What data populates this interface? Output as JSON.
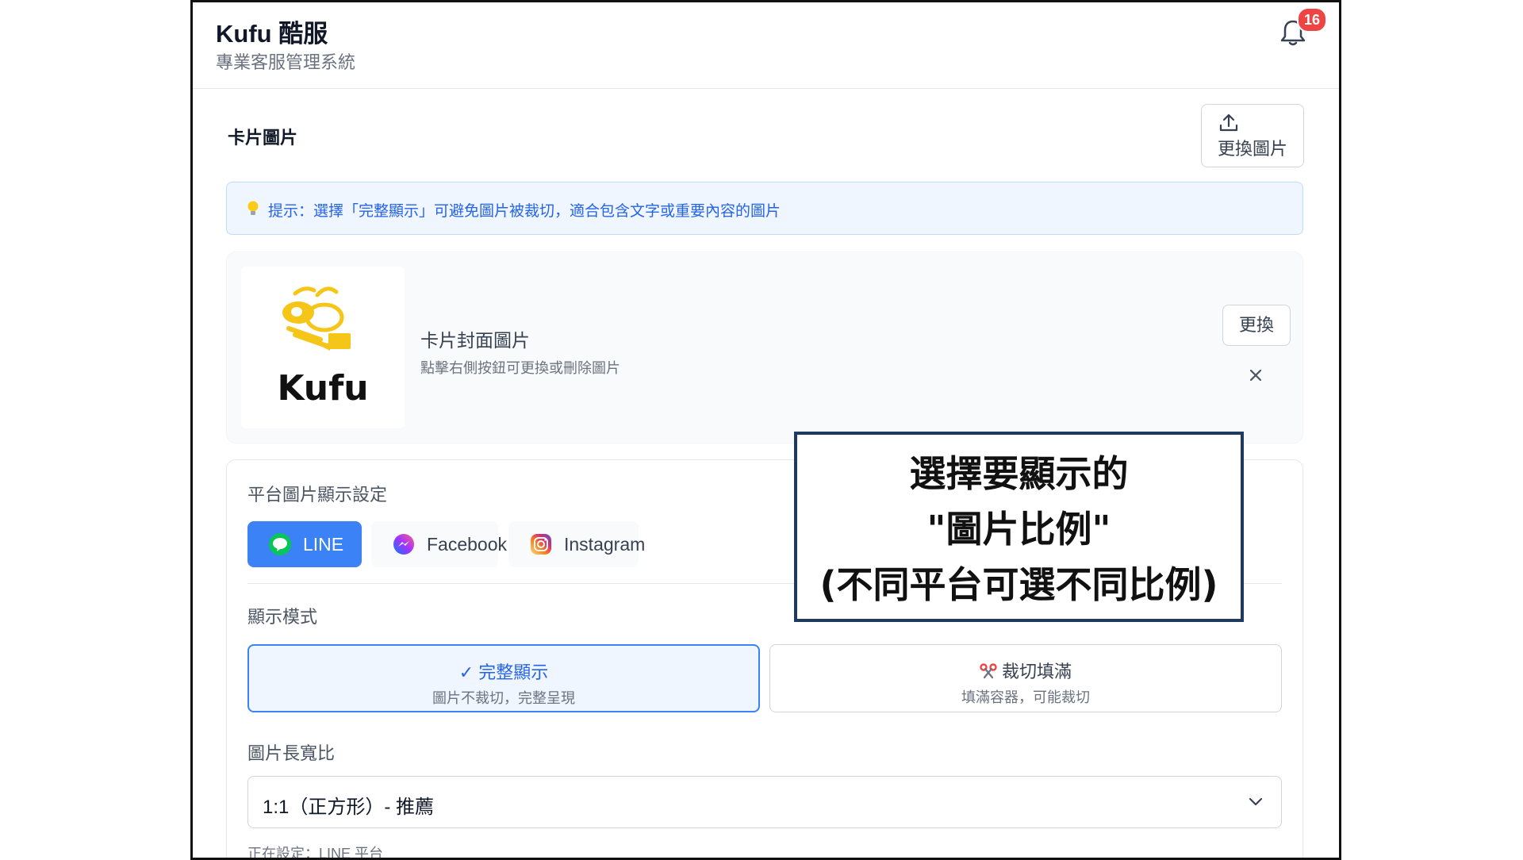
{
  "header": {
    "app_title": "Kufu 酷服",
    "app_subtitle": "專業客服管理系統",
    "notification_count": "16"
  },
  "card_image": {
    "section_label": "卡片圖片",
    "upload_button_label": "更換圖片",
    "tip": "提示：選擇「完整顯示」可避免圖片被裁切，適合包含文字或重要內容的圖片",
    "cover_title": "卡片封面圖片",
    "cover_desc": "點擊右側按鈕可更換或刪除圖片",
    "logo_text": "Kufu",
    "replace_label": "更換"
  },
  "platform_settings": {
    "title": "平台圖片顯示設定",
    "tabs": [
      {
        "label": "LINE",
        "icon": "line-icon",
        "active": true
      },
      {
        "label": "Facebook",
        "icon": "messenger-icon",
        "active": false
      },
      {
        "label": "Instagram",
        "icon": "instagram-icon",
        "active": false
      }
    ],
    "mode_title": "顯示模式",
    "modes": [
      {
        "title": "✓ 完整顯示",
        "desc": "圖片不裁切，完整呈現",
        "selected": true
      },
      {
        "title": "裁切填滿",
        "desc": "填滿容器，可能裁切",
        "selected": false
      }
    ],
    "ratio_title": "圖片長寬比",
    "ratio_value": "1:1（正方形）- 推薦",
    "ratio_note": "正在設定：LINE 平台"
  },
  "callout": {
    "line1": "選擇要顯示的",
    "line2": "\"圖片比例\"",
    "line3": "(不同平台可選不同比例)"
  },
  "colors": {
    "accent": "#3b82f6",
    "badge": "#ef4444",
    "tip_bg": "#eff6ff",
    "logo_yellow": "#f5c518",
    "callout_border": "#1e3a5f"
  }
}
